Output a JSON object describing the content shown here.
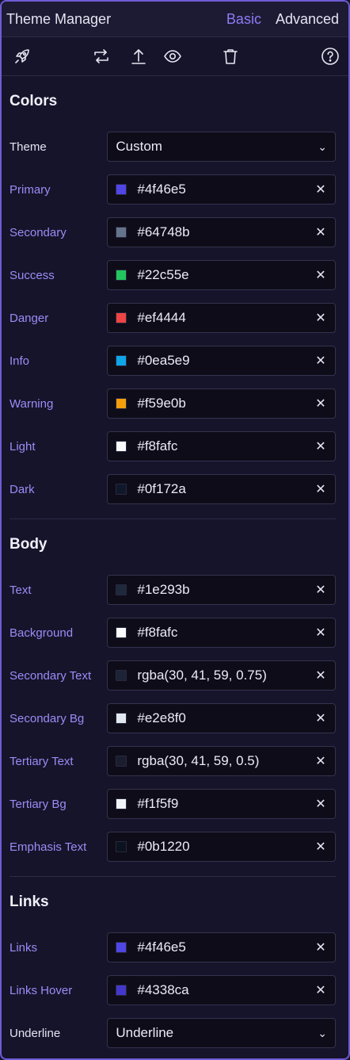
{
  "header": {
    "title": "Theme Manager",
    "tab_basic": "Basic",
    "tab_advanced": "Advanced"
  },
  "toolbar": {
    "icons": [
      "rocket-icon",
      "transfer-icon",
      "upload-icon",
      "eye-icon",
      "trash-icon",
      "help-icon"
    ]
  },
  "colors": {
    "title": "Colors",
    "theme": {
      "label": "Theme",
      "value": "Custom"
    },
    "items": [
      {
        "label": "Primary",
        "value": "#4f46e5",
        "swatch": "#4f46e5"
      },
      {
        "label": "Secondary",
        "value": "#64748b",
        "swatch": "#64748b"
      },
      {
        "label": "Success",
        "value": "#22c55e",
        "swatch": "#22c55e"
      },
      {
        "label": "Danger",
        "value": "#ef4444",
        "swatch": "#ef4444"
      },
      {
        "label": "Info",
        "value": "#0ea5e9",
        "swatch": "#0ea5e9"
      },
      {
        "label": "Warning",
        "value": "#f59e0b",
        "swatch": "#f59e0b"
      },
      {
        "label": "Light",
        "value": "#f8fafc",
        "swatch": "#f8fafc"
      },
      {
        "label": "Dark",
        "value": "#0f172a",
        "swatch": "#0f172a"
      }
    ]
  },
  "body": {
    "title": "Body",
    "items": [
      {
        "label": "Text",
        "value": "#1e293b",
        "swatch": "#1e293b"
      },
      {
        "label": "Background",
        "value": "#f8fafc",
        "swatch": "#f8fafc"
      },
      {
        "label": "Secondary Text",
        "value": "rgba(30, 41, 59, 0.75)",
        "swatch": "#1c2336"
      },
      {
        "label": "Secondary Bg",
        "value": "#e2e8f0",
        "swatch": "#e2e8f0"
      },
      {
        "label": "Tertiary Text",
        "value": "rgba(30, 41, 59, 0.5)",
        "swatch": "#191d2e"
      },
      {
        "label": "Tertiary Bg",
        "value": "#f1f5f9",
        "swatch": "#f1f5f9"
      },
      {
        "label": "Emphasis Text",
        "value": "#0b1220",
        "swatch": "#0b1220"
      }
    ]
  },
  "links": {
    "title": "Links",
    "items": [
      {
        "label": "Links",
        "value": "#4f46e5",
        "swatch": "#4f46e5"
      },
      {
        "label": "Links Hover",
        "value": "#4338ca",
        "swatch": "#4338ca"
      }
    ],
    "underline": {
      "label": "Underline",
      "value": "Underline"
    }
  },
  "glyphs": {
    "clear": "✕",
    "chevron": "⌄"
  }
}
